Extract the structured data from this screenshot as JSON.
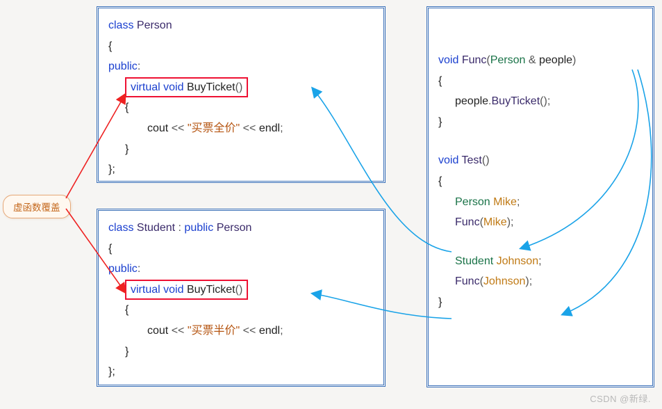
{
  "badge": "虚函数覆盖",
  "watermark": "CSDN @新绿.",
  "person": {
    "decl_kw": "class",
    "name": "Person",
    "access": "public",
    "method_virtual": "virtual",
    "method_ret": "void",
    "method_name": "BuyTicket",
    "method_parens": "()",
    "body_cout": "cout",
    "body_op": "<<",
    "body_str": "\"买票全价\"",
    "body_endl": "endl"
  },
  "student": {
    "decl_kw": "class",
    "name": "Student",
    "inherit_sep": ":",
    "inherit_acc": "public",
    "inherit_base": "Person",
    "access": "public",
    "method_virtual": "virtual",
    "method_ret": "void",
    "method_name": "BuyTicket",
    "method_parens": "()",
    "body_cout": "cout",
    "body_op": "<<",
    "body_str": "\"买票半价\"",
    "body_endl": "endl"
  },
  "right": {
    "func_ret": "void",
    "func_name": "Func",
    "func_param_type": "Person",
    "func_param_amp": "&",
    "func_param_name": "people",
    "func_body_obj": "people",
    "func_body_call": "BuyTicket",
    "test_ret": "void",
    "test_name": "Test",
    "var1_type": "Person",
    "var1_name": "Mike",
    "call1_fn": "Func",
    "call1_arg": "Mike",
    "var2_type": "Student",
    "var2_name": "Johnson",
    "call2_fn": "Func",
    "call2_arg": "Johnson"
  }
}
